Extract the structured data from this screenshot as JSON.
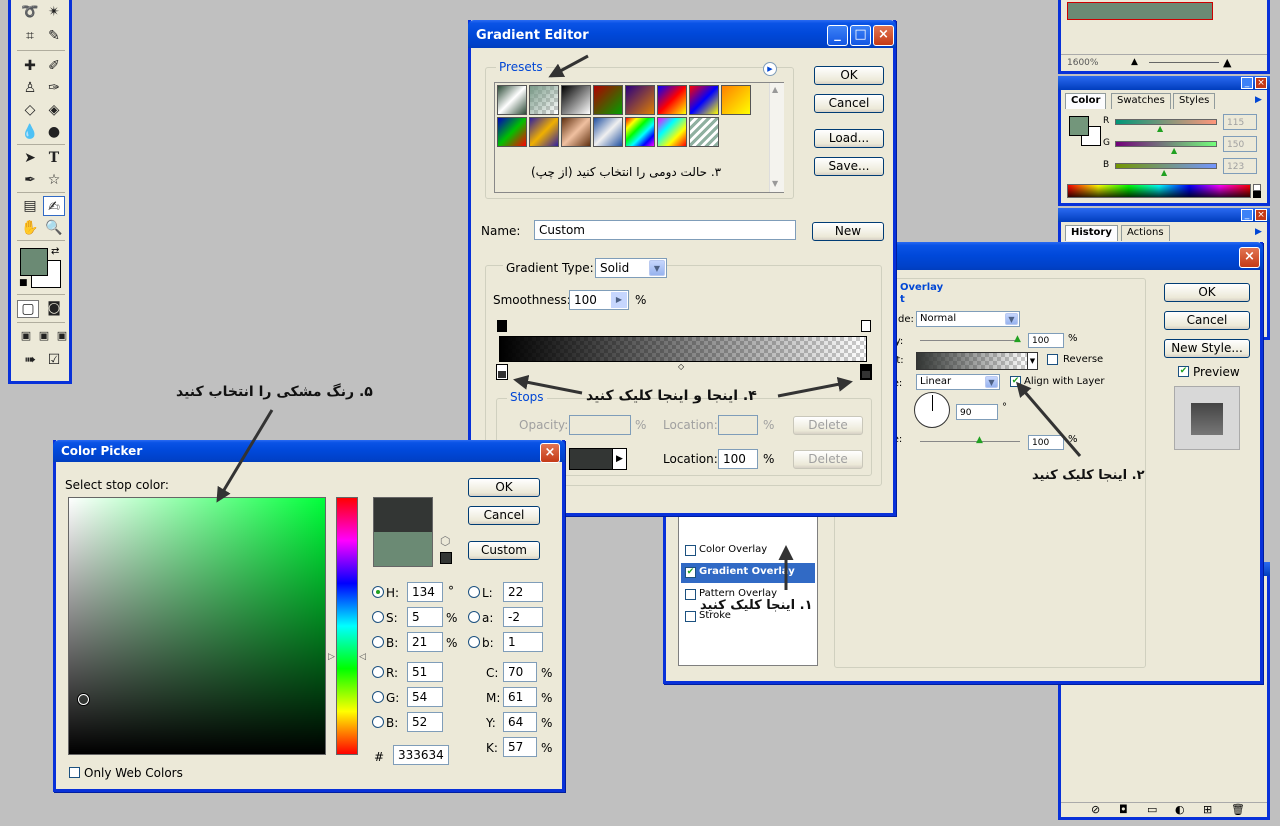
{
  "gradient_editor": {
    "title": "Gradient Editor",
    "presets_label": "Presets",
    "buttons": {
      "ok": "OK",
      "cancel": "Cancel",
      "load": "Load...",
      "save": "Save...",
      "new": "New"
    },
    "name_label": "Name:",
    "name_value": "Custom",
    "gradient_type_label": "Gradient Type:",
    "gradient_type_value": "Solid",
    "smoothness_label": "Smoothness:",
    "smoothness_value": "100",
    "percent": "%",
    "stops_label": "Stops",
    "opacity_label": "Opacity:",
    "location_label": "Location:",
    "location_value": "100",
    "delete_label": "Delete",
    "preset_note": "۳. حالت دومی را انتخاب کنید (از چپ)",
    "presets": [
      {
        "name": "preset-1",
        "bg": "linear-gradient(135deg,#2d4b37,#ffffff 50%,#2d4b37)"
      },
      {
        "name": "preset-2",
        "bg": "checker-green"
      },
      {
        "name": "preset-3",
        "bg": "linear-gradient(135deg,#000,#fff)"
      },
      {
        "name": "preset-4",
        "bg": "linear-gradient(135deg,#b00000,#00a000)"
      },
      {
        "name": "preset-5",
        "bg": "linear-gradient(135deg,#2a0080,#e08000)"
      },
      {
        "name": "preset-6",
        "bg": "linear-gradient(135deg,#0000ff,#ff0000,#ffff00)"
      },
      {
        "name": "preset-7",
        "bg": "linear-gradient(135deg,#ff0000,#0000ff,#ffff00)"
      },
      {
        "name": "preset-8",
        "bg": "linear-gradient(135deg,#ff8000,#ffff00)"
      },
      {
        "name": "preset-9",
        "bg": "linear-gradient(135deg,#0000c0,#00c000,#ff0000)"
      },
      {
        "name": "preset-10",
        "bg": "linear-gradient(135deg,#3020a0,#f0b000,#3020a0)"
      },
      {
        "name": "preset-11",
        "bg": "linear-gradient(135deg,#603010,#f0c0a0,#603010)"
      },
      {
        "name": "preset-12",
        "bg": "linear-gradient(135deg,#2050a0,#f0f0f0,#2050a0)"
      },
      {
        "name": "preset-13",
        "bg": "linear-gradient(135deg,#ff0000,#ffff00,#00ff00,#00ffff,#0000ff,#ff00ff)"
      },
      {
        "name": "preset-14",
        "bg": "linear-gradient(135deg,#ff00ff,#00ffff,#ffff00,#ff0000)"
      },
      {
        "name": "preset-15",
        "bg": "repeating-linear-gradient(135deg,#8fb0a0 0 3px,#ffffff 3px 6px)"
      }
    ]
  },
  "layer_style": {
    "section_title": "Overlay",
    "section_sub": "t",
    "blend_label": "de:",
    "blend_value": "Normal",
    "opacity_label": "ity:",
    "opacity_value": "100",
    "gradient_label": "nt:",
    "reverse_label": "Reverse",
    "style_label": "le:",
    "style_value": "Linear",
    "align_label": "Align with Layer",
    "angle_value": "90",
    "degree": "°",
    "scale_label": "le:",
    "scale_value": "100",
    "percent": "%",
    "buttons": {
      "ok": "OK",
      "cancel": "Cancel",
      "new_style": "New Style..."
    },
    "preview_label": "Preview",
    "styles_list": [
      "Color Overlay",
      "Gradient Overlay",
      "Pattern Overlay",
      "Stroke"
    ],
    "styles_checked": [
      false,
      true,
      false,
      false
    ]
  },
  "color_picker": {
    "title": "Color Picker",
    "select_label": "Select stop color:",
    "buttons": {
      "ok": "OK",
      "cancel": "Cancel",
      "custom": "Custom"
    },
    "fields": {
      "H": "134",
      "S": "5",
      "Bv": "21",
      "L": "22",
      "a": "-2",
      "b": "1",
      "R": "51",
      "G": "54",
      "B": "52",
      "C": "70",
      "M": "61",
      "Y": "64",
      "K": "57"
    },
    "labels": {
      "H": "H:",
      "S": "S:",
      "Bv": "B:",
      "L": "L:",
      "a": "a:",
      "b": "b:",
      "R": "R:",
      "G": "G:",
      "B": "B:",
      "C": "C:",
      "M": "M:",
      "Y": "Y:",
      "K": "K:",
      "deg": "°",
      "pct": "%",
      "hash": "#"
    },
    "hex": "333634",
    "only_web_colors": "Only Web Colors",
    "new_color": "#333634",
    "old_color": "#6b8a74"
  },
  "color_panel": {
    "tabs": [
      "Color",
      "Swatches",
      "Styles"
    ],
    "r_label": "R",
    "g_label": "G",
    "b_label": "B",
    "r_value": "115",
    "g_value": "150",
    "b_value": "123",
    "fg_color": "#73967b"
  },
  "history_panel": {
    "tabs": [
      "History",
      "Actions"
    ]
  },
  "navigator": {
    "zoom": "1600%"
  },
  "annotations": {
    "step1": "۱. اینجا کلیک کنید",
    "step2": "۲. اینجا کلیک کنید",
    "step4": "۴. اینجا و اینجا کلیک کنید",
    "step5": "۵. رنگ مشکی را انتخاب کنید"
  },
  "toolbox": {
    "fg_color": "#6b8a74",
    "bg_color": "#ffffff"
  }
}
